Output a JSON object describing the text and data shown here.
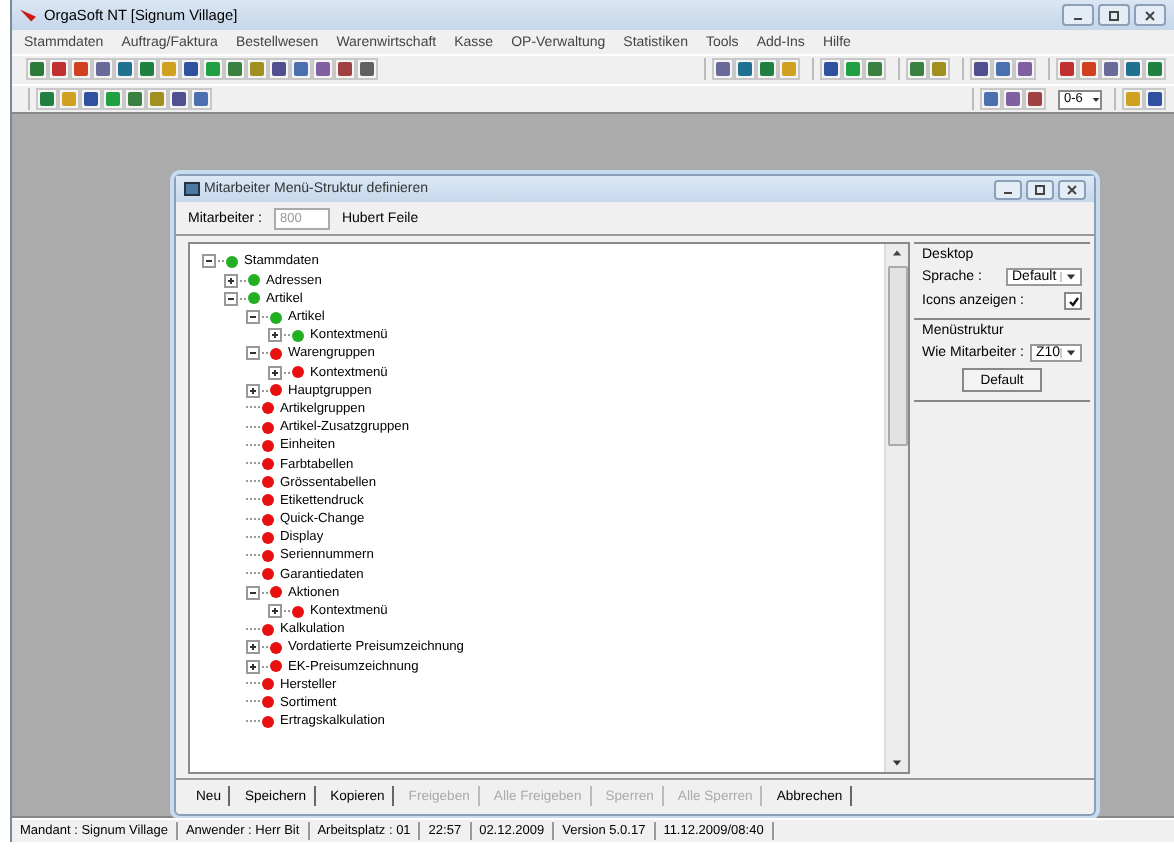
{
  "window": {
    "title": "OrgaSoft NT [Signum Village]"
  },
  "menu": [
    "Stammdaten",
    "Auftrag/Faktura",
    "Bestellwesen",
    "Warenwirtschaft",
    "Kasse",
    "OP-Verwaltung",
    "Statistiken",
    "Tools",
    "Add-Ins",
    "Hilfe"
  ],
  "toolbar2": {
    "range_dropdown": "0-6"
  },
  "dialog": {
    "title": "Mitarbeiter Menü-Struktur definieren",
    "employee": {
      "label": "Mitarbeiter :",
      "number": "800",
      "name": "Hubert Feile"
    },
    "tree": [
      {
        "label": "Stammdaten",
        "color": "#22b022",
        "kind": "node",
        "expanded": true,
        "children": [
          {
            "label": "Adressen",
            "color": "#22b022",
            "kind": "node",
            "expanded": false
          },
          {
            "label": "Artikel",
            "color": "#22b022",
            "kind": "node",
            "expanded": true,
            "children": [
              {
                "label": "Artikel",
                "color": "#22b022",
                "kind": "node",
                "expanded": true,
                "children": [
                  {
                    "label": "Kontextmenü",
                    "color": "#22b022",
                    "kind": "node",
                    "expanded": false
                  }
                ]
              },
              {
                "label": "Warengruppen",
                "color": "#e81010",
                "kind": "node",
                "expanded": true,
                "children": [
                  {
                    "label": "Kontextmenü",
                    "color": "#e81010",
                    "kind": "node",
                    "expanded": false
                  }
                ]
              },
              {
                "label": "Hauptgruppen",
                "color": "#e81010",
                "kind": "node",
                "expanded": false
              },
              {
                "label": "Artikelgruppen",
                "color": "#e81010",
                "kind": "leaf"
              },
              {
                "label": "Artikel-Zusatzgruppen",
                "color": "#e81010",
                "kind": "leaf"
              },
              {
                "label": "Einheiten",
                "color": "#e81010",
                "kind": "leaf"
              },
              {
                "label": "Farbtabellen",
                "color": "#e81010",
                "kind": "leaf"
              },
              {
                "label": "Grössentabellen",
                "color": "#e81010",
                "kind": "leaf"
              },
              {
                "label": "Etikettendruck",
                "color": "#e81010",
                "kind": "leaf"
              },
              {
                "label": "Quick-Change",
                "color": "#e81010",
                "kind": "leaf"
              },
              {
                "label": "Display",
                "color": "#e81010",
                "kind": "leaf"
              },
              {
                "label": "Seriennummern",
                "color": "#e81010",
                "kind": "leaf"
              },
              {
                "label": "Garantiedaten",
                "color": "#e81010",
                "kind": "leaf"
              },
              {
                "label": "Aktionen",
                "color": "#e81010",
                "kind": "node",
                "expanded": true,
                "children": [
                  {
                    "label": "Kontextmenü",
                    "color": "#e81010",
                    "kind": "node",
                    "expanded": false
                  }
                ]
              },
              {
                "label": "Kalkulation",
                "color": "#e81010",
                "kind": "leaf"
              },
              {
                "label": "Vordatierte Preisumzeichnung",
                "color": "#e81010",
                "kind": "node",
                "expanded": false
              },
              {
                "label": "EK-Preisumzeichnung",
                "color": "#e81010",
                "kind": "node",
                "expanded": false
              },
              {
                "label": "Hersteller",
                "color": "#e81010",
                "kind": "leaf"
              },
              {
                "label": "Sortiment",
                "color": "#e81010",
                "kind": "leaf"
              },
              {
                "label": "Ertragskalkulation",
                "color": "#e81010",
                "kind": "leaf"
              }
            ]
          }
        ]
      }
    ],
    "desktop": {
      "heading": "Desktop",
      "language_label": "Sprache :",
      "language": "Default",
      "icons_label": "Icons anzeigen :",
      "icons_checked": true
    },
    "menu_structure": {
      "heading": "Menüstruktur",
      "like_label": "Wie Mitarbeiter :",
      "like_value": "Z10",
      "default_button": "Default"
    },
    "buttons": [
      {
        "label": "Neu",
        "disabled": false
      },
      {
        "label": "Speichern",
        "disabled": false
      },
      {
        "label": "Kopieren",
        "disabled": false
      },
      {
        "label": "Freigeben",
        "disabled": true
      },
      {
        "label": "Alle Freigeben",
        "disabled": true
      },
      {
        "label": "Sperren",
        "disabled": true
      },
      {
        "label": "Alle Sperren",
        "disabled": true
      },
      {
        "label": "Abbrechen",
        "disabled": false
      }
    ]
  },
  "status_bar": [
    "Mandant : Signum Village",
    "Anwender : Herr Bit",
    "Arbeitsplatz : 01",
    "22:57",
    "02.12.2009",
    "Version 5.0.17",
    "11.12.2009/08:40"
  ]
}
